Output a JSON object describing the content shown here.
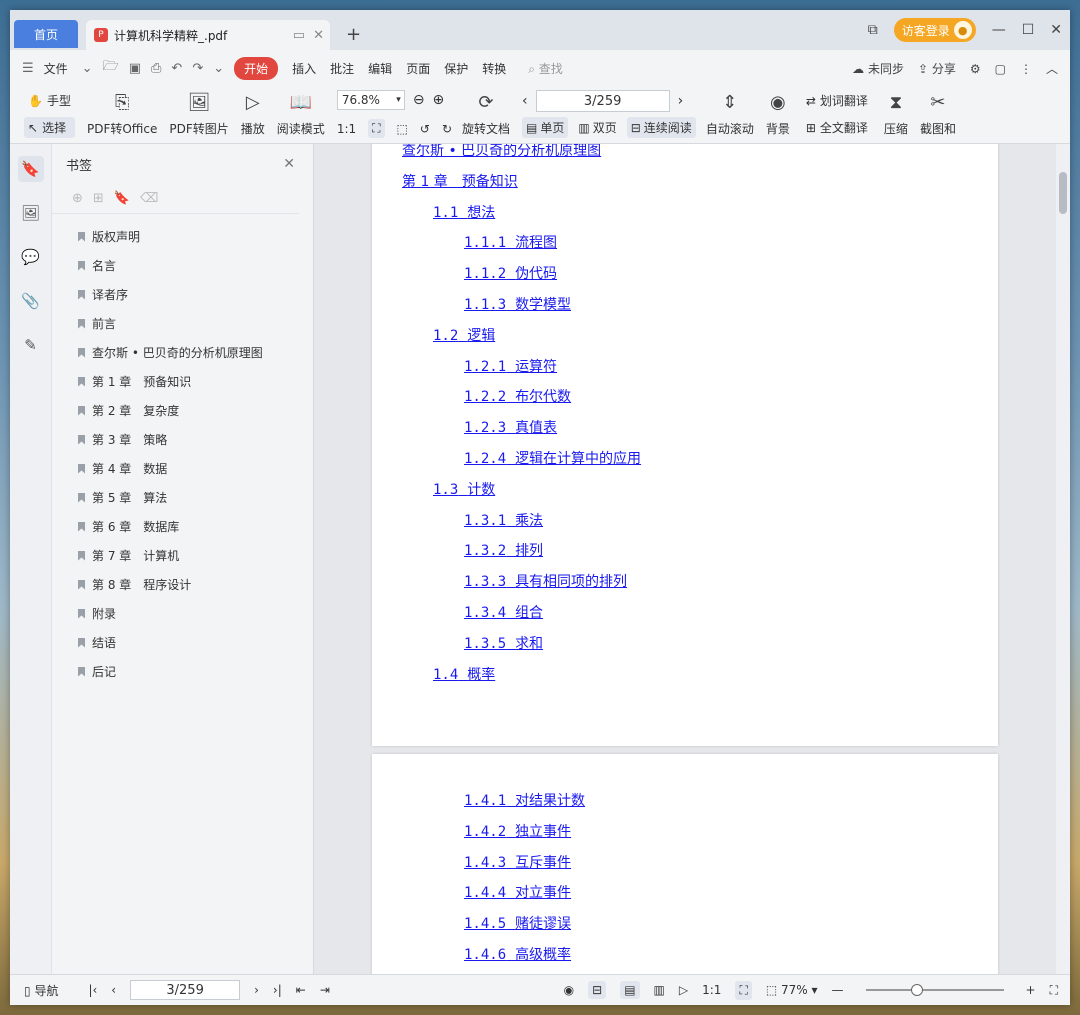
{
  "titlebar": {
    "home_tab": "首页",
    "doc_tab": "计算机科学精粹_.pdf",
    "login": "访客登录"
  },
  "menu": {
    "file": "文件",
    "items": [
      "开始",
      "插入",
      "批注",
      "编辑",
      "页面",
      "保护",
      "转换"
    ],
    "search": "查找",
    "sync": "未同步",
    "share": "分享"
  },
  "ribbon": {
    "hand": "手型",
    "select": "选择",
    "pdf_to_office": "PDF转Office",
    "pdf_to_image": "PDF转图片",
    "play": "播放",
    "read_mode": "阅读模式",
    "zoom": "76.8%",
    "rotate": "旋转文档",
    "page": "3/259",
    "single": "单页",
    "double": "双页",
    "continuous": "连续阅读",
    "autoscroll": "自动滚动",
    "background": "背景",
    "word_translate": "划词翻译",
    "full_translate": "全文翻译",
    "compress": "压缩",
    "screenshot": "截图和"
  },
  "sidebar": {
    "title": "书签",
    "bookmarks": [
      "版权声明",
      "名言",
      "译者序",
      "前言",
      "查尔斯 • 巴贝奇的分析机原理图",
      "第 1 章　预备知识",
      "第 2 章　复杂度",
      "第 3 章　策略",
      "第 4 章　数据",
      "第 5 章　算法",
      "第 6 章　数据库",
      "第 7 章　计算机",
      "第 8 章　程序设计",
      "附录",
      "结语",
      "后记"
    ]
  },
  "document": {
    "page1_toc": [
      {
        "num": "",
        "text": "查尔斯 • 巴贝奇的分析机原理图",
        "level": 0
      },
      {
        "num": "",
        "text": "第 1 章　预备知识",
        "level": 0
      },
      {
        "num": "1.1",
        "text": "想法",
        "level": 1
      },
      {
        "num": "1.1.1",
        "text": "流程图",
        "level": 2
      },
      {
        "num": "1.1.2",
        "text": "伪代码",
        "level": 2
      },
      {
        "num": "1.1.3",
        "text": "数学模型",
        "level": 2
      },
      {
        "num": "1.2",
        "text": "逻辑",
        "level": 1
      },
      {
        "num": "1.2.1",
        "text": "运算符",
        "level": 2
      },
      {
        "num": "1.2.2",
        "text": "布尔代数",
        "level": 2
      },
      {
        "num": "1.2.3",
        "text": "真值表",
        "level": 2
      },
      {
        "num": "1.2.4",
        "text": "逻辑在计算中的应用",
        "level": 2
      },
      {
        "num": "1.3",
        "text": "计数",
        "level": 1
      },
      {
        "num": "1.3.1",
        "text": "乘法",
        "level": 2
      },
      {
        "num": "1.3.2",
        "text": "排列",
        "level": 2
      },
      {
        "num": "1.3.3",
        "text": "具有相同项的排列",
        "level": 2
      },
      {
        "num": "1.3.4",
        "text": "组合",
        "level": 2
      },
      {
        "num": "1.3.5",
        "text": "求和",
        "level": 2
      },
      {
        "num": "1.4",
        "text": "概率",
        "level": 1
      }
    ],
    "page2_toc": [
      {
        "num": "1.4.1",
        "text": "对结果计数",
        "level": 2
      },
      {
        "num": "1.4.2",
        "text": "独立事件",
        "level": 2
      },
      {
        "num": "1.4.3",
        "text": "互斥事件",
        "level": 2
      },
      {
        "num": "1.4.4",
        "text": "对立事件",
        "level": 2
      },
      {
        "num": "1.4.5",
        "text": "赌徒谬误",
        "level": 2
      },
      {
        "num": "1.4.6",
        "text": "高级概率",
        "level": 2
      }
    ]
  },
  "status": {
    "nav": "导航",
    "page": "3/259",
    "zoom": "77%",
    "zoom_level": 0.37
  }
}
